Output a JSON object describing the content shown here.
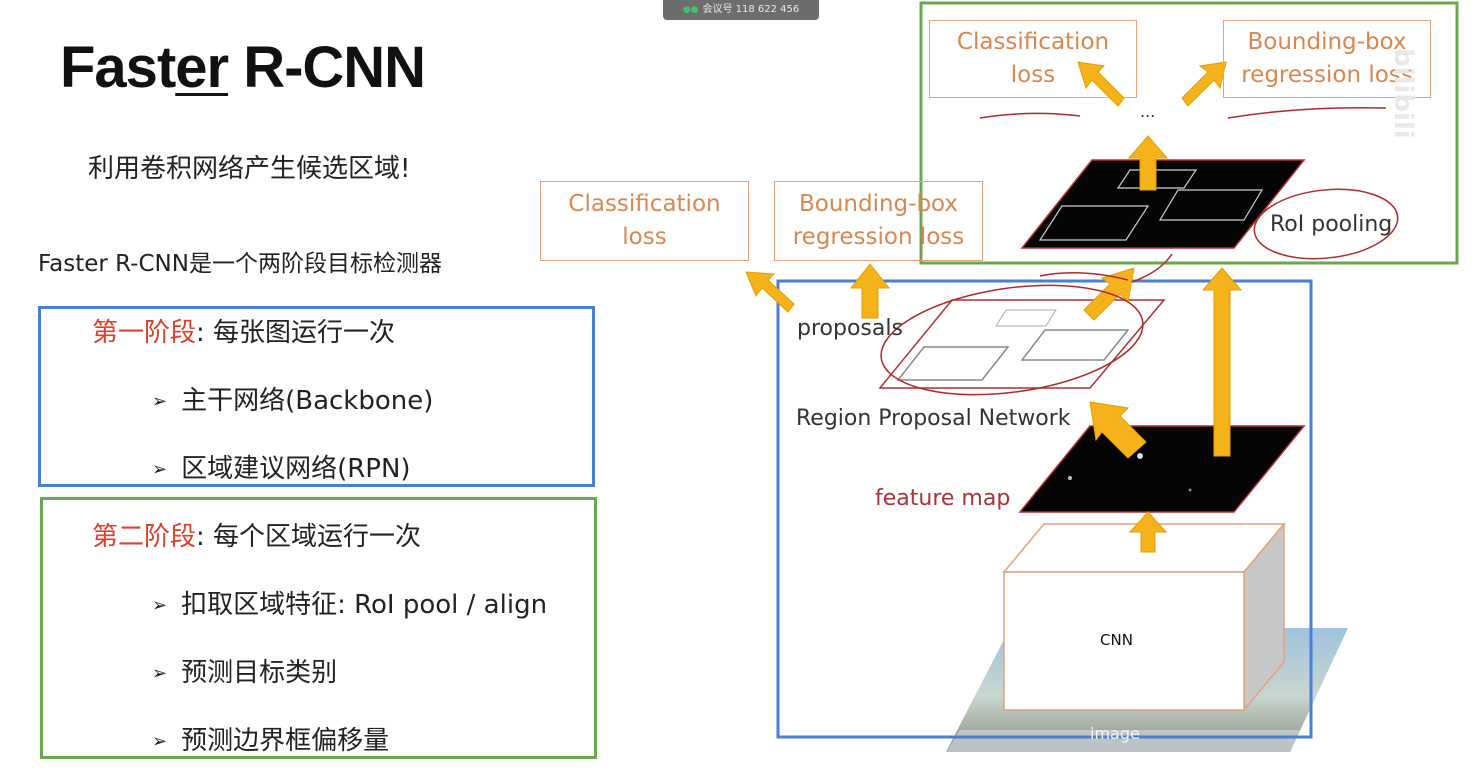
{
  "overlay": {
    "meeting_label": "会议号 118 622 456"
  },
  "slide": {
    "title_pre": "Fast",
    "title_ul": "er",
    "title_post": " R-CNN",
    "subtitle": "利用卷积网络产生候选区域!",
    "intro": "Faster R-CNN是一个两阶段目标检测器",
    "stage1": {
      "label": "第一阶段",
      "text": ": 每张图运行一次",
      "items": [
        "主干网络(Backbone)",
        "区域建议网络(RPN)"
      ]
    },
    "stage2": {
      "label": "第二阶段",
      "text": ": 每个区域运行一次",
      "items": [
        "扣取区域特征: RoI pool / align",
        "预测目标类别",
        "预测边界框偏移量"
      ]
    }
  },
  "diagram": {
    "top_cls_l1": "Classification",
    "top_cls_l2": "loss",
    "top_bb_l1": "Bounding-box",
    "top_bb_l2": "regression loss",
    "ellipsis": "...",
    "mid_cls_l1": "Classification",
    "mid_cls_l2": "loss",
    "mid_bb_l1": "Bounding-box",
    "mid_bb_l2": "regression loss",
    "roi_pooling": "RoI pooling",
    "proposals": "proposals",
    "rpn": "Region Proposal Network",
    "feature_map": "feature map",
    "cnn": "CNN",
    "image": "image"
  },
  "colors": {
    "blue_box": "#4a7fd6",
    "green_box": "#6aa84f",
    "stage_red": "#e0402a",
    "arrow": "#f5b21a",
    "loss_text": "#d9874f",
    "annotation": "#b02a2a"
  },
  "watermark": "bilibili"
}
